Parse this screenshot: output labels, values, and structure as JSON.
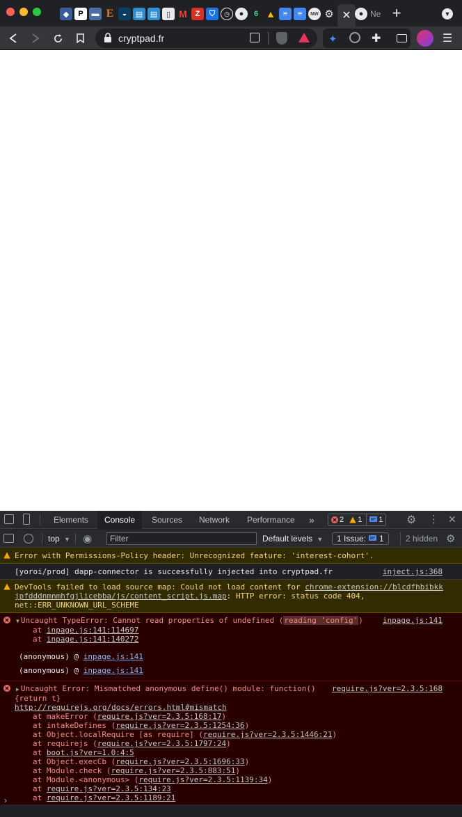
{
  "browser": {
    "url": "cryptpad.fr",
    "tab_favicons": [
      "lab-icon",
      "p-icon",
      "wiki-icon",
      "e-icon",
      "stream-icon",
      "docker-icon",
      "docker2-icon",
      "doc-icon",
      "gmail-icon",
      "z-icon",
      "shield-icon",
      "history-icon",
      "github-icon",
      "leaf-icon",
      "drive-icon",
      "gdocs-icon",
      "gdocs2-icon",
      "news-icon",
      "settings-icon"
    ],
    "active_tab_close": "✕",
    "partial_tab_label": "Ne",
    "new_tab_symbol": "+"
  },
  "devtools": {
    "tabs": [
      "Elements",
      "Console",
      "Sources",
      "Network",
      "Performance"
    ],
    "active_tab": "Console",
    "more_tabs": "»",
    "error_count": "2",
    "warning_count": "1",
    "message_count": "1",
    "context": "top",
    "filter_placeholder": "Filter",
    "levels": "Default levels",
    "issues_label": "1 Issue:",
    "issues_count": "1",
    "hidden": "2 hidden"
  },
  "console": {
    "msg1": {
      "text": "Error with Permissions-Policy header: Unrecognized feature: 'interest-cohort'."
    },
    "msg2": {
      "text": "[yoroi/prod] dapp-connector is successfully injected into cryptpad.fr",
      "source": "inject.js:368"
    },
    "msg3": {
      "pre": "DevTools failed to load source map: Could not load content for ",
      "link": "chrome-extension://blcdfhbibkk",
      "link2": "jpfdddnmnmhfgjlicebba/js/content_script.js.map",
      "post": ": HTTP error: status code 404,",
      "line2": "net::ERR_UNKNOWN_URL_SCHEME"
    },
    "msg4": {
      "pre": "Uncaught TypeError: Cannot read properties of undefined (",
      "hl": "reading 'config'",
      "post": ")",
      "source": "inpage.js:141",
      "stack1_pre": "at ",
      "stack1_link": "inpage.js:141:114697",
      "stack2_pre": "at ",
      "stack2_link": "inpage.js:141:140272",
      "anon1_pre": "(anonymous) @ ",
      "anon1_link": "inpage.js:141",
      "anon2_pre": "(anonymous) @ ",
      "anon2_link": "inpage.js:141"
    },
    "msg5": {
      "title": "Uncaught Error: Mismatched anonymous define() module: function()",
      "source": "require.js?ver=2.3.5:168",
      "line2": "{return t}",
      "url": "http://requirejs.org/docs/errors.html#mismatch",
      "frames": [
        {
          "pre": "at makeError (",
          "link": "require.js?ver=2.3.5:168:17",
          "post": ")"
        },
        {
          "pre": "at intakeDefines (",
          "link": "require.js?ver=2.3.5:1254:36",
          "post": ")"
        },
        {
          "pre": "at Object.localRequire [as require] (",
          "link": "require.js?ver=2.3.5:1446:21",
          "post": ")"
        },
        {
          "pre": "at requirejs (",
          "link": "require.js?ver=2.3.5:1797:24",
          "post": ")"
        },
        {
          "pre": "at ",
          "link": "boot.js?ver=1.0:4:5",
          "post": ""
        },
        {
          "pre": "at Object.execCb (",
          "link": "require.js?ver=2.3.5:1696:33",
          "post": ")"
        },
        {
          "pre": "at Module.check (",
          "link": "require.js?ver=2.3.5:883:51",
          "post": ")"
        },
        {
          "pre": "at Module.<anonymous> (",
          "link": "require.js?ver=2.3.5:1139:34",
          "post": ")"
        },
        {
          "pre": "at ",
          "link": "require.js?ver=2.3.5:134:23",
          "post": ""
        },
        {
          "pre": "at ",
          "link": "require.js?ver=2.3.5:1189:21",
          "post": ""
        }
      ]
    },
    "prompt": "›"
  }
}
